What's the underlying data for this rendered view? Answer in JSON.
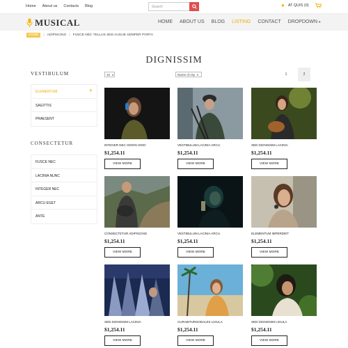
{
  "topbar": {
    "links": [
      "Home",
      "About us",
      "Contacts",
      "Blog"
    ],
    "search_placeholder": "Search",
    "user_label": "AT QUIS (0)"
  },
  "brand": {
    "name": "MUSICAL"
  },
  "nav": {
    "items": [
      "HOME",
      "ABOUT US",
      "BLOG",
      "LISTING",
      "CONTACT",
      "DROPDOWN"
    ],
    "active": "LISTING"
  },
  "breadcrumb": {
    "items": [
      "HOME",
      "ADIPISCING",
      "FUSCE NEC TELLUS SED AUGUE SEMPER PORTA"
    ]
  },
  "page_title": "DIGNISSIM",
  "sidebar": {
    "section1": {
      "heading": "VESTIBULUM",
      "items": [
        "ELEMENTUM",
        "SAGITTIS",
        "PRAESENT"
      ],
      "active_index": 0
    },
    "section2": {
      "heading": "CONSECTETUR",
      "items": [
        "FUSCE NEC",
        "LACINIA NUNC",
        "INTEGER NEC",
        "ARCU EGET",
        "ANTE"
      ]
    }
  },
  "filters": {
    "per_page": "10",
    "sort": "Name of city"
  },
  "pagination": {
    "pages": [
      "1",
      "2"
    ],
    "current": "2"
  },
  "products": [
    {
      "title": "INTEGER NEC ODION ODIO",
      "price": "$1,254.11",
      "button": "VIEW MORE"
    },
    {
      "title": "VESTIBULUM LACINIA ARCU",
      "price": "$1,254.11",
      "button": "VIEW MORE"
    },
    {
      "title": "SED DIGNISSIM LACINIA",
      "price": "$1,254.11",
      "button": "VIEW MORE"
    },
    {
      "title": "CONSECTETUR ADIPISCING",
      "price": "$1,254.11",
      "button": "VIEW MORE"
    },
    {
      "title": "VESTIBULUM LACINIA arcu",
      "price": "$1,254.11",
      "button": "VIEW MORE"
    },
    {
      "title": "ELEMENTUM IMPERDIET",
      "price": "$1,254.11",
      "button": "VIEW MORE"
    },
    {
      "title": "SED DIGNISSIM LACINIA",
      "price": "$1,254.11",
      "button": "VIEW MORE"
    },
    {
      "title": "CURABITURSODALES LIGULA",
      "price": "$1,254.11",
      "button": "VIEW MORE"
    },
    {
      "title": "SED DIGNISSIM LIGULA",
      "price": "$1,254.11",
      "button": "VIEW MORE"
    }
  ],
  "colors": {
    "accent": "#f0a900",
    "search_button": "#e04e4e",
    "navbar_bg": "#f3f3f3"
  }
}
